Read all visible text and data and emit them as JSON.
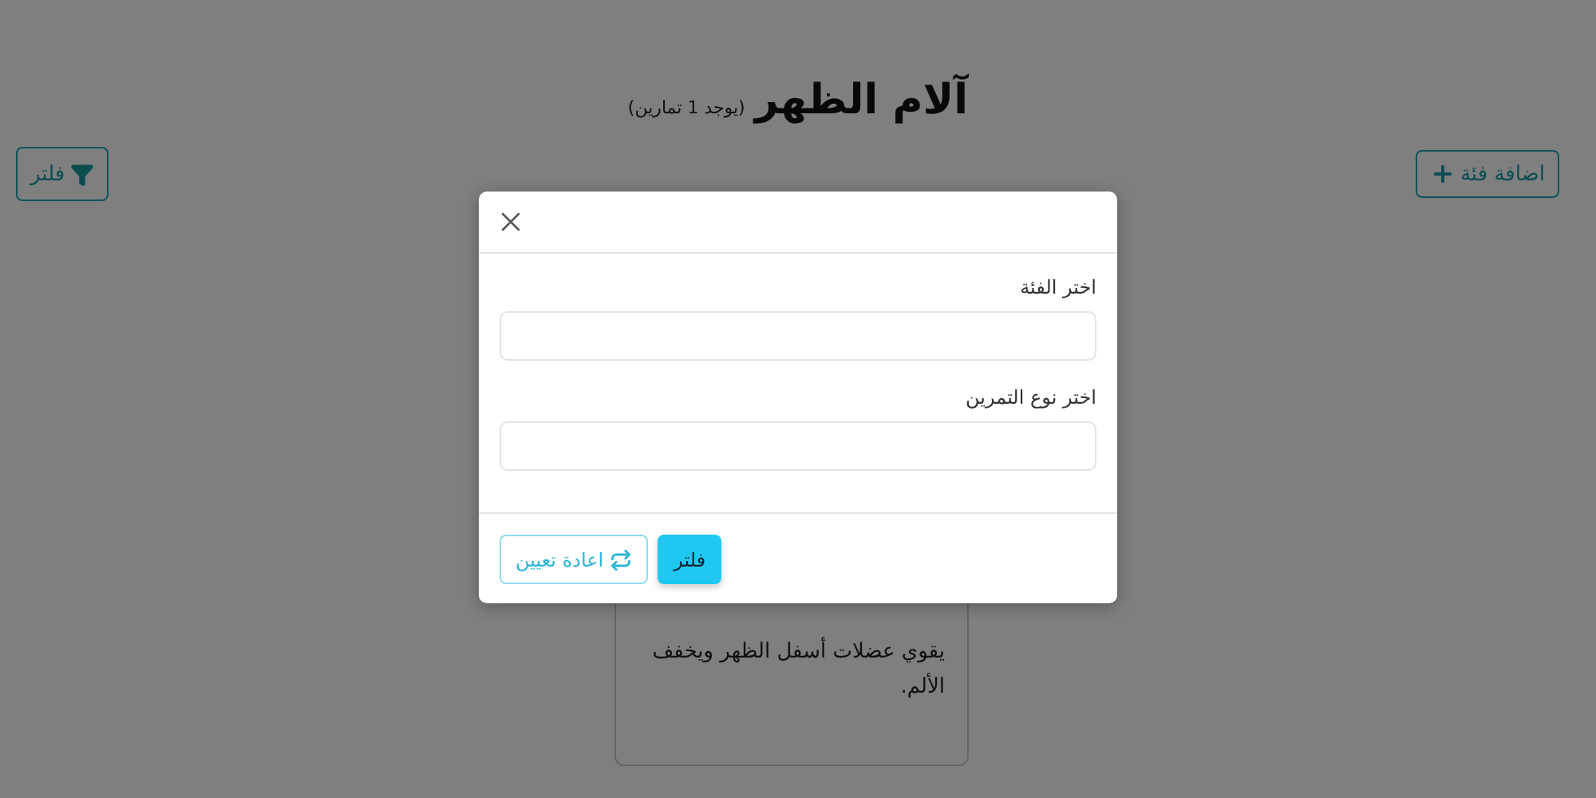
{
  "page": {
    "title": "آلام الظهر",
    "count_note": "(يوجد 1 تمارين)",
    "filter_button": "فلتر",
    "add_button": "اضافة فئة"
  },
  "card": {
    "description": "يقوي عضلات أسفل الظهر ويخفف الألم."
  },
  "dialog": {
    "fields": [
      {
        "label": "اختر الفئة"
      },
      {
        "label": "اختر نوع التمرين"
      }
    ],
    "buttons": [
      {
        "label": "فلتر",
        "kind": "primary"
      },
      {
        "label": "اعادة تعيين",
        "kind": "outline"
      }
    ]
  }
}
